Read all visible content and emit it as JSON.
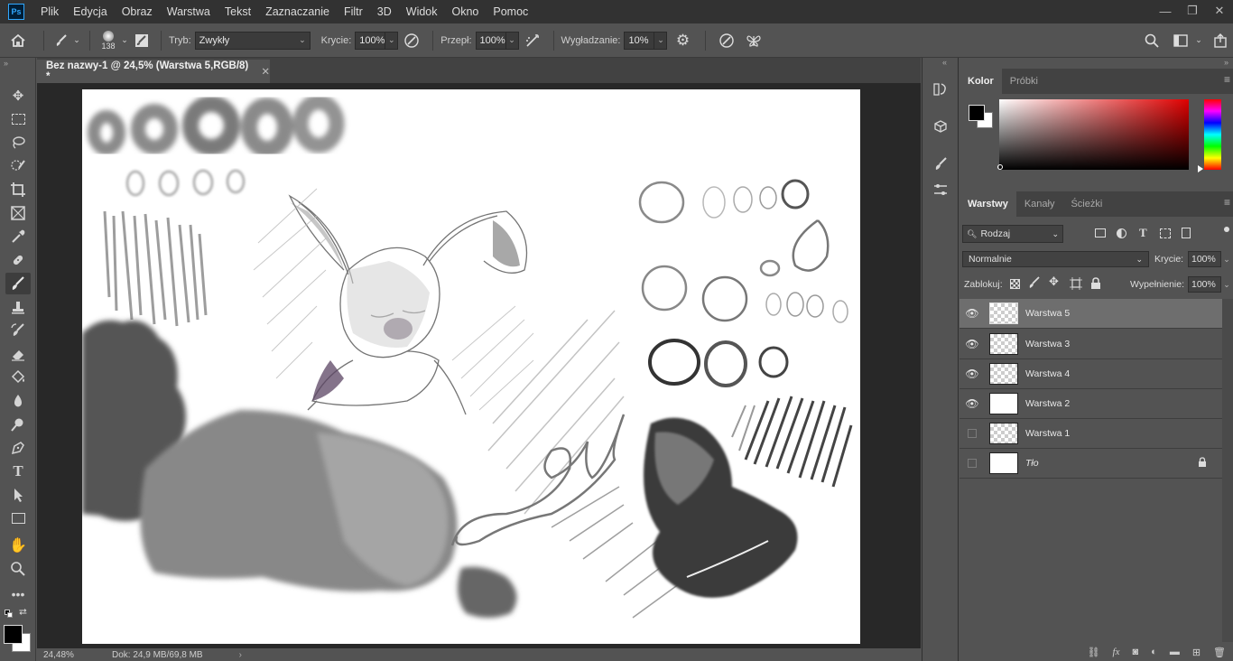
{
  "menubar": {
    "logo": "Ps",
    "items": [
      "Plik",
      "Edycja",
      "Obraz",
      "Warstwa",
      "Tekst",
      "Zaznaczanie",
      "Filtr",
      "3D",
      "Widok",
      "Okno",
      "Pomoc"
    ]
  },
  "options": {
    "brush_size": "138",
    "mode_label": "Tryb:",
    "mode_value": "Zwykły",
    "opacity_label": "Krycie:",
    "opacity_value": "100%",
    "flow_label": "Przepł:",
    "flow_value": "100%",
    "smoothing_label": "Wygładzanie:",
    "smoothing_value": "10%"
  },
  "document": {
    "tab_title": "Bez nazwy-1 @ 24,5% (Warstwa 5,RGB/8) *",
    "zoom": "24,48%",
    "doc_info": "Dok: 24,9 MB/69,8 MB"
  },
  "color_panel": {
    "tabs": [
      "Kolor",
      "Próbki"
    ],
    "foreground": "#000000",
    "background": "#ffffff",
    "hue_color": "#e00000"
  },
  "layers_panel": {
    "tabs": [
      "Warstwy",
      "Kanały",
      "Ścieżki"
    ],
    "filter_label": "Rodzaj",
    "blend_mode": "Normalnie",
    "opacity_label": "Krycie:",
    "opacity_value": "100%",
    "lock_label": "Zablokuj:",
    "fill_label": "Wypełnienie:",
    "fill_value": "100%",
    "layers": [
      {
        "name": "Warstwa 5",
        "visible": true,
        "selected": true
      },
      {
        "name": "Warstwa 3",
        "visible": true,
        "selected": false
      },
      {
        "name": "Warstwa 4",
        "visible": true,
        "selected": false
      },
      {
        "name": "Warstwa 2",
        "visible": true,
        "selected": false
      },
      {
        "name": "Warstwa 1",
        "visible": false,
        "selected": false
      },
      {
        "name": "Tło",
        "visible": false,
        "selected": false
      }
    ]
  }
}
